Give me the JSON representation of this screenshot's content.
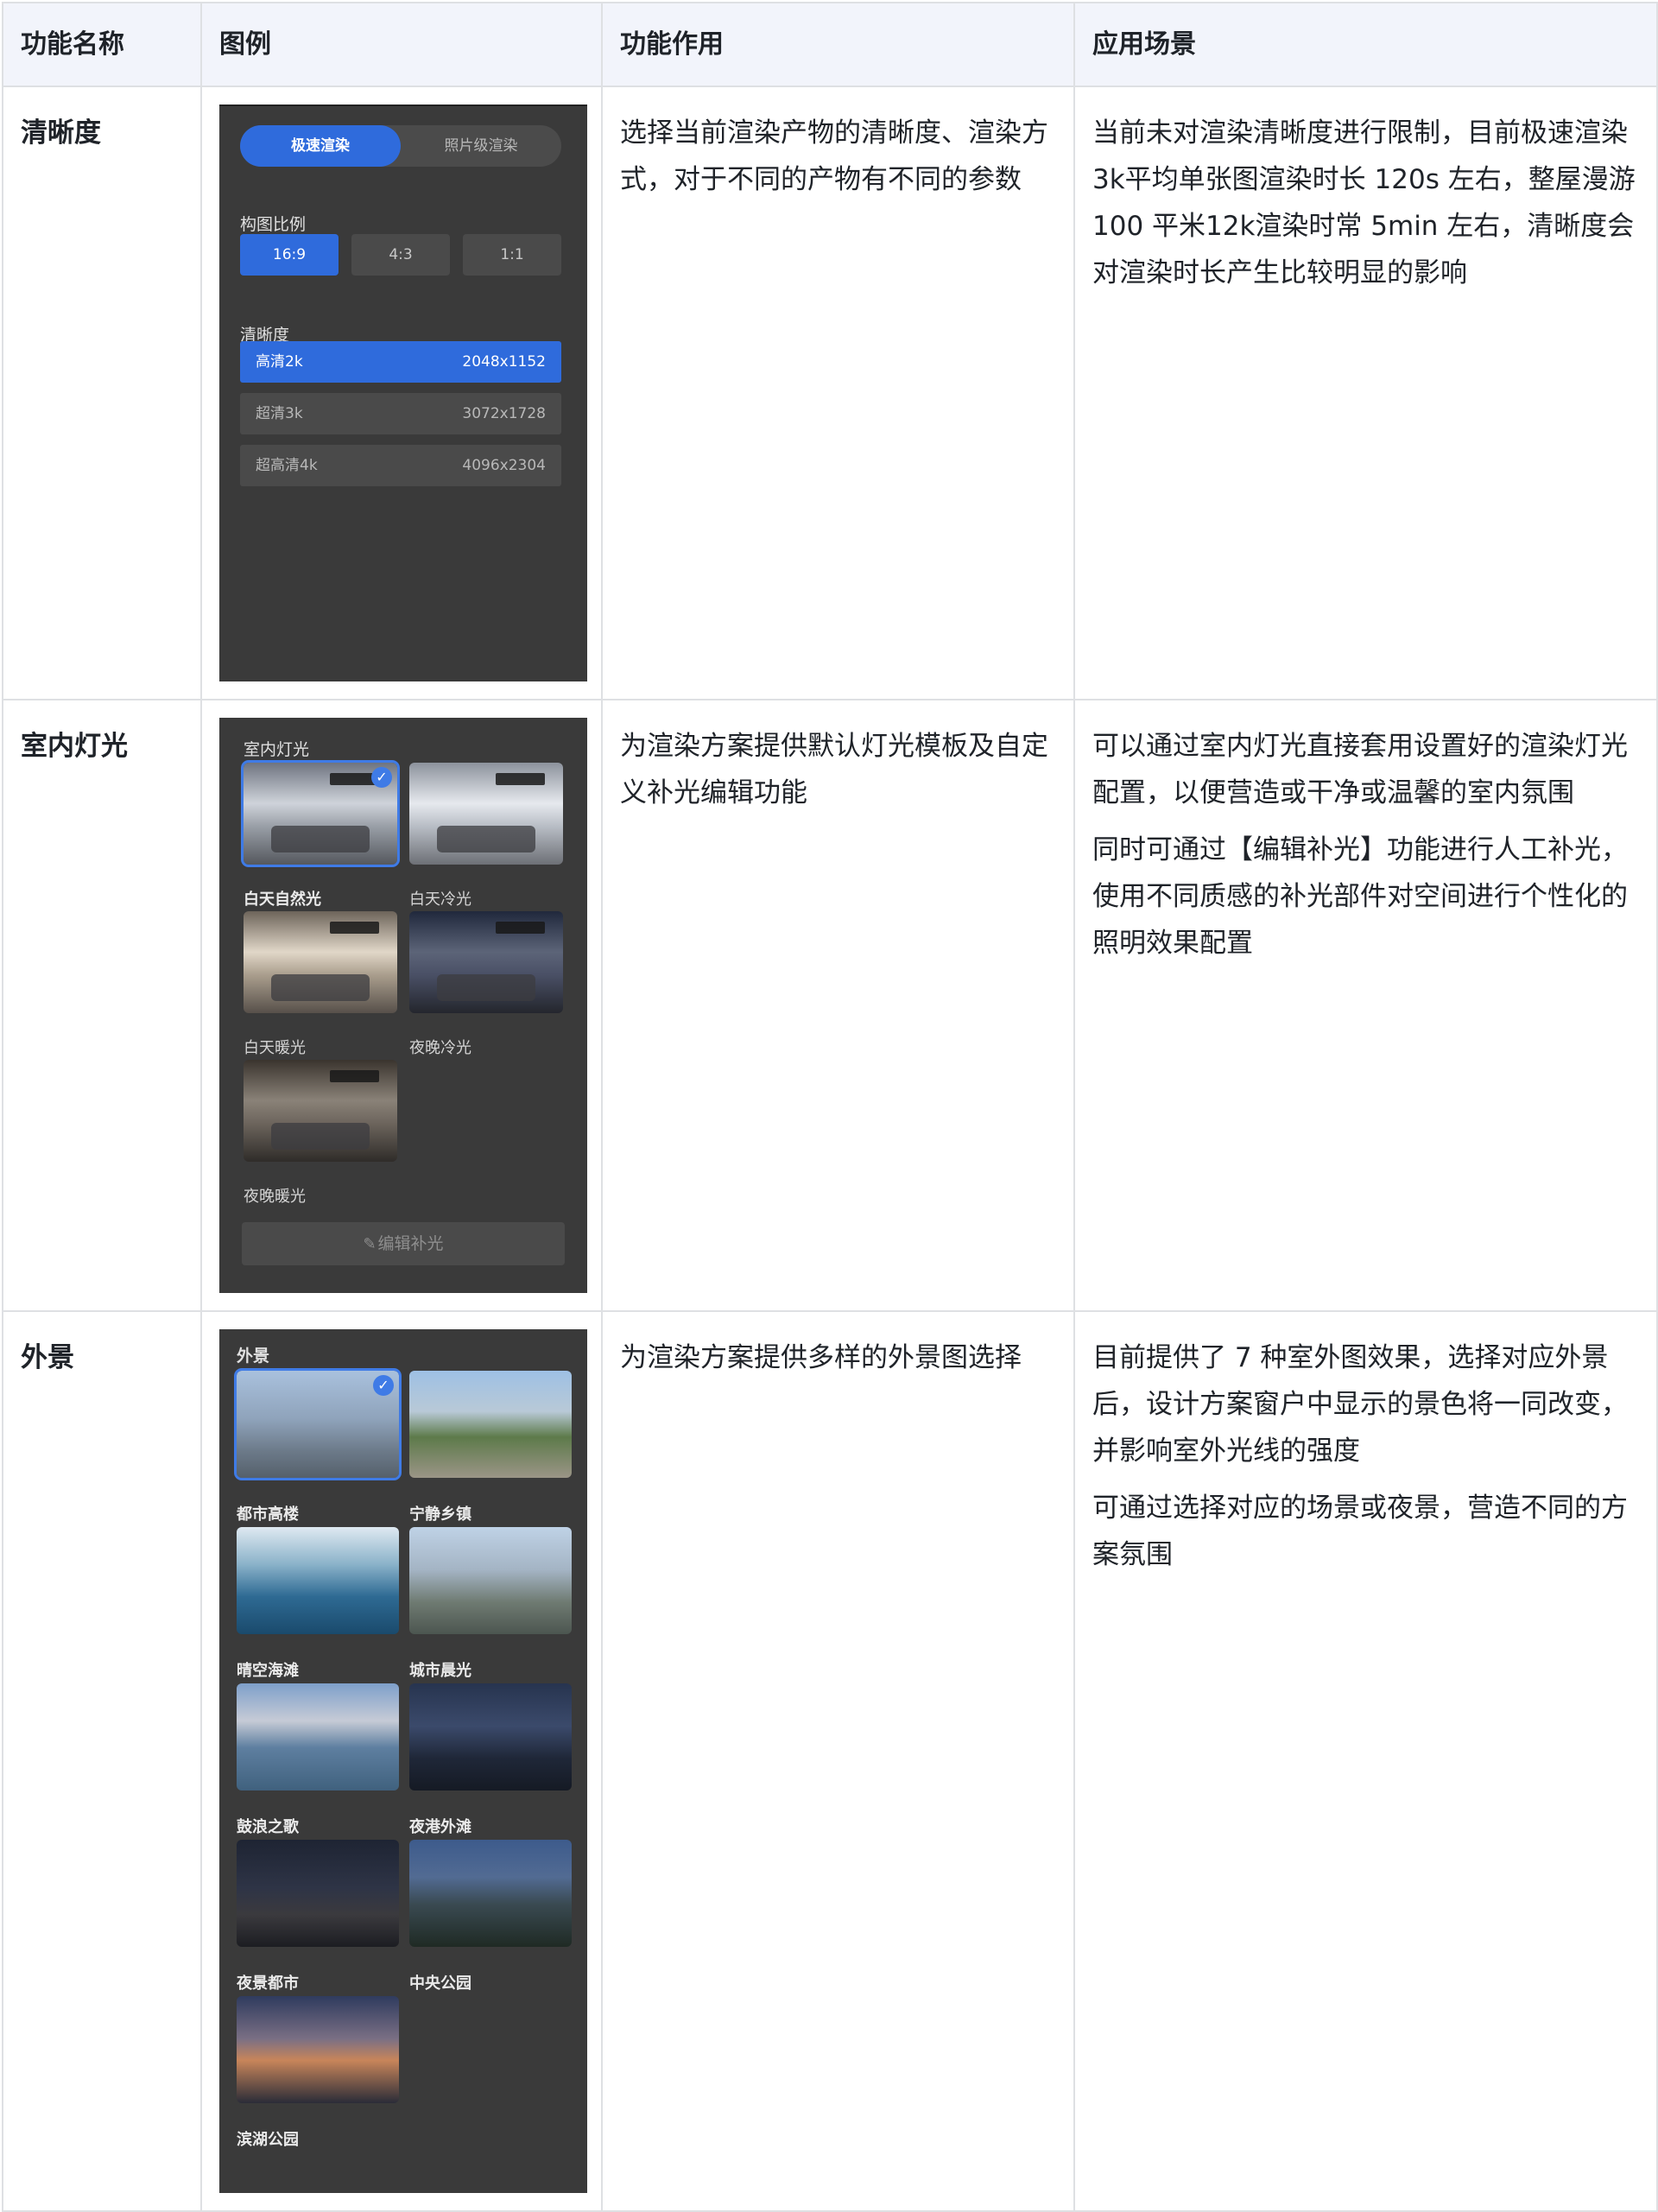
{
  "headers": [
    "功能名称",
    "图例",
    "功能作用",
    "应用场景"
  ],
  "rows": [
    {
      "name": "清晰度",
      "function": "选择当前渲染产物的清晰度、渲染方式，对于不同的产物有不同的参数",
      "scenario": [
        "当前未对渲染清晰度进行限制，目前极速渲染3k平均单张图渲染时长 120s 左右，整屋漫游 100 平米12k渲染时常 5min 左右，清晰度会对渲染时长产生比较明显的影响"
      ]
    },
    {
      "name": "室内灯光",
      "function": "为渲染方案提供默认灯光模板及自定义补光编辑功能",
      "scenario": [
        "可以通过室内灯光直接套用设置好的渲染灯光配置，以便营造或干净或温馨的室内氛围",
        "同时可通过【编辑补光】功能进行人工补光，使用不同质感的补光部件对空间进行个性化的照明效果配置"
      ]
    },
    {
      "name": "外景",
      "function": "为渲染方案提供多样的外景图选择",
      "scenario": [
        "目前提供了 7 种室外图效果，选择对应外景后，设计方案窗户中显示的景色将一同改变，并影响室外光线的强度",
        "可通过选择对应的场景或夜景，营造不同的方案氛围"
      ]
    }
  ],
  "sharpness_panel": {
    "mode_active": "极速渲染",
    "mode_inactive": "照片级渲染",
    "ratio_label": "构图比例",
    "ratios": [
      "16:9",
      "4:3",
      "1:1"
    ],
    "ratio_selected": "16:9",
    "resolution_label": "清晰度",
    "resolutions": [
      {
        "name": "高清2k",
        "size": "2048x1152"
      },
      {
        "name": "超清3k",
        "size": "3072x1728"
      },
      {
        "name": "超高清4k",
        "size": "4096x2304"
      }
    ],
    "resolution_selected": "高清2k"
  },
  "light_panel": {
    "title": "室内灯光",
    "options": [
      "白天自然光",
      "白天冷光",
      "白天暖光",
      "夜晚冷光",
      "夜晚暖光"
    ],
    "selected": "白天自然光",
    "edit_button": "编辑补光",
    "check_icon": "check-icon",
    "edit_icon": "pencil-icon"
  },
  "exterior_panel": {
    "title": "外景",
    "options": [
      "都市高楼",
      "宁静乡镇",
      "晴空海滩",
      "城市晨光",
      "鼓浪之歌",
      "夜港外滩",
      "夜景都市",
      "中央公园",
      "滨湖公园"
    ],
    "selected": "都市高楼"
  },
  "colors": {
    "header_bg": "#f2f4fb",
    "border": "#dee0e3",
    "panel_bg": "#3a3a3a",
    "accent": "#2f6bdc"
  }
}
